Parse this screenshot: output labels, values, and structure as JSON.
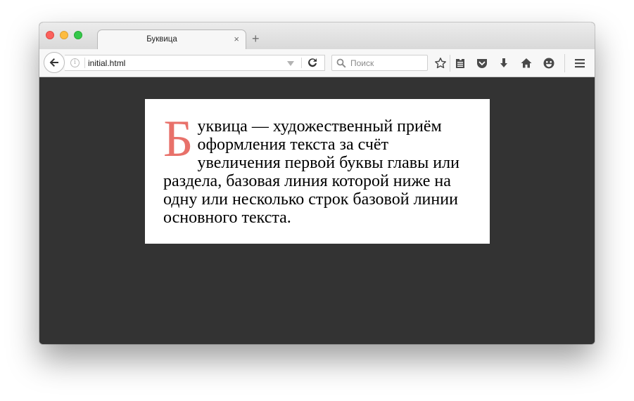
{
  "window": {
    "tab": {
      "title": "Буквица",
      "close_symbol": "×",
      "new_tab_symbol": "+"
    },
    "toolbar": {
      "url": "initial.html",
      "search_placeholder": "Поиск",
      "info_symbol": "i",
      "icons": [
        "back-arrow-icon",
        "info-icon",
        "dropdown-arrow-icon",
        "reload-icon",
        "search-icon",
        "bookmark-star-icon",
        "reading-list-icon",
        "pocket-icon",
        "download-icon",
        "home-icon",
        "smiley-icon",
        "menu-icon"
      ]
    }
  },
  "content": {
    "drop_cap": "Б",
    "paragraph": "уквица — художественный приём оформления текста за счёт увеличения первой буквы главы или раздела, базовая линия которой ниже на одну или несколько строк базовой линии основного текста.",
    "drop_cap_color": "#e8716a",
    "background_color": "#333333"
  },
  "colors": {
    "traffic_red": "#fc615d",
    "traffic_yellow": "#fdbc40",
    "traffic_green": "#34c84a"
  }
}
